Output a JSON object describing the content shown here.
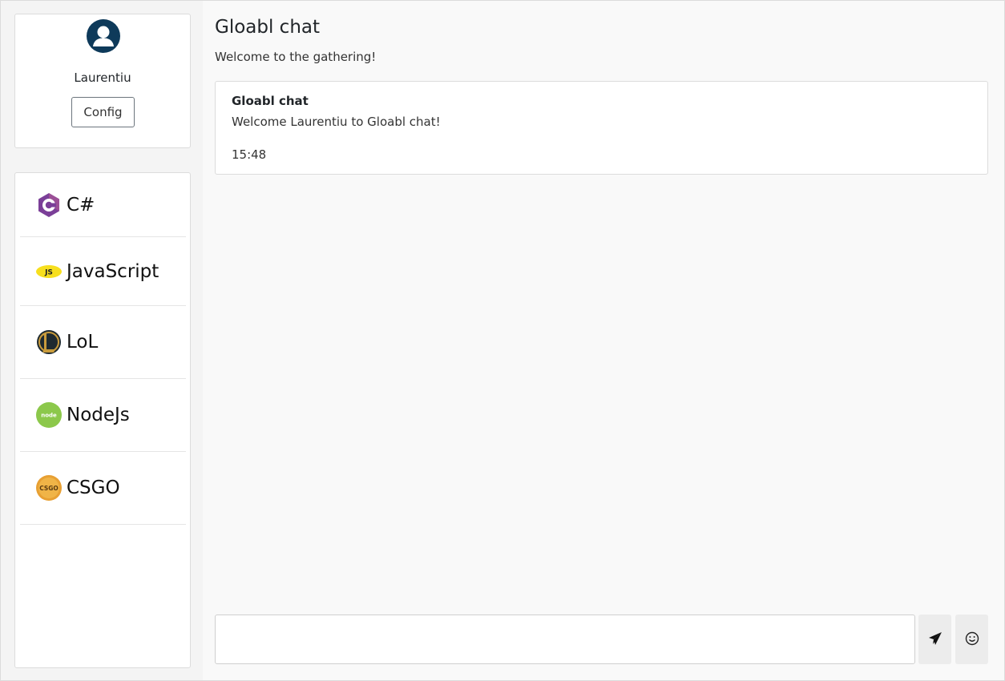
{
  "user": {
    "name": "Laurentiu",
    "config_label": "Config"
  },
  "channels": [
    {
      "label": "C#",
      "icon": "csharp-icon"
    },
    {
      "label": "JavaScript",
      "icon": "javascript-icon"
    },
    {
      "label": "LoL",
      "icon": "lol-icon"
    },
    {
      "label": "NodeJs",
      "icon": "nodejs-icon"
    },
    {
      "label": "CSGO",
      "icon": "csgo-icon"
    }
  ],
  "chat": {
    "title": "Gloabl chat",
    "subtitle": "Welcome to the gathering!",
    "messages": [
      {
        "author": "Gloabl chat",
        "text": "Welcome Laurentiu to Gloabl chat!",
        "time": "15:48"
      }
    ],
    "composer_value": ""
  },
  "icons": {
    "send": "send-icon",
    "emoji": "emoji-icon"
  },
  "colors": {
    "avatar": "#0e3a5a",
    "csharp": "#7b3f98",
    "javascript": "#f7df1e",
    "nodejs": "#8cc84b",
    "csgo": "#e8a033"
  }
}
